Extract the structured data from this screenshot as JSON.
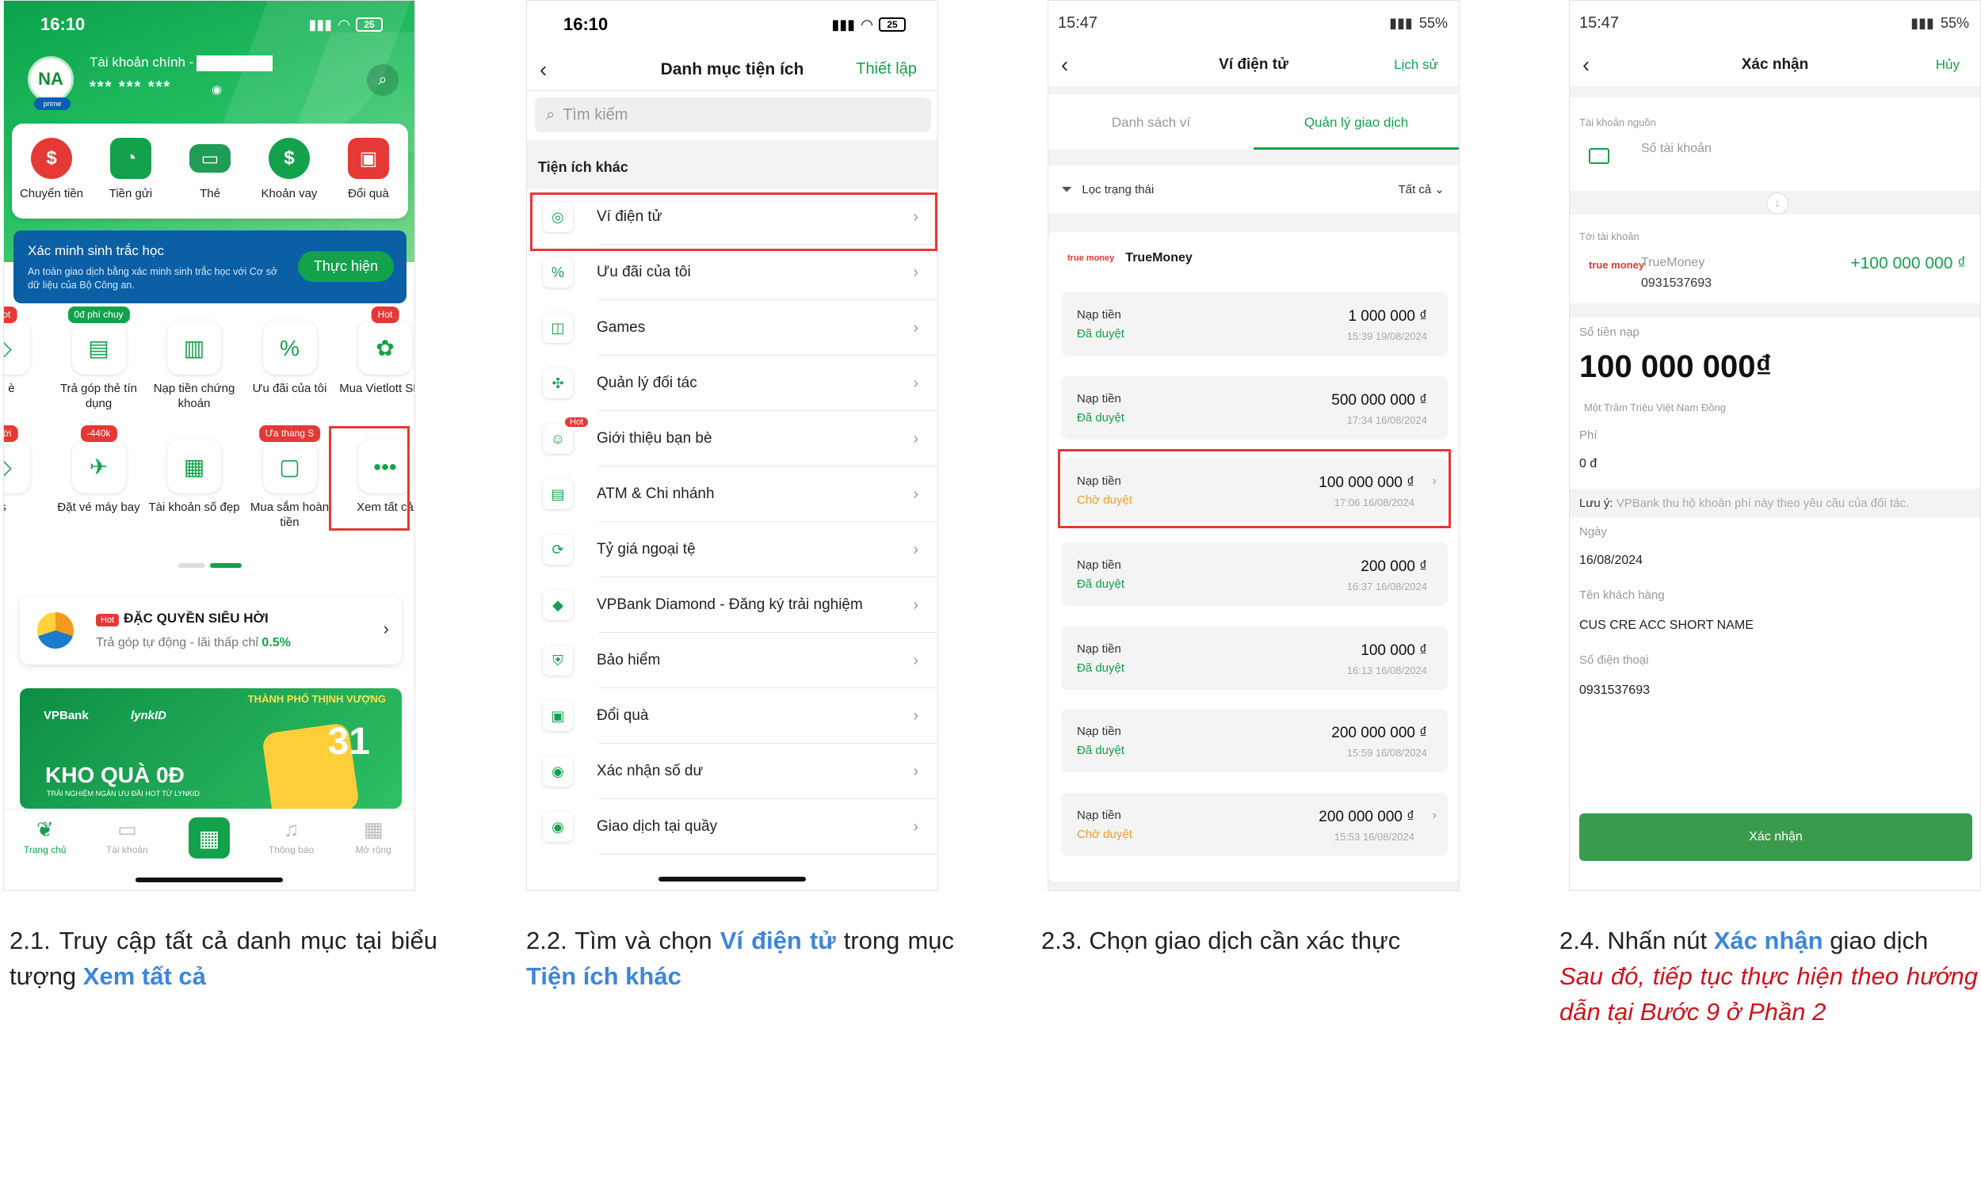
{
  "colors": {
    "brand_green": "#12a24b",
    "link_blue": "#3d86dc",
    "highlight_red": "#e53935",
    "pending_orange": "#f0a024"
  },
  "step1": {
    "status_time": "16:10",
    "battery": "25",
    "avatar_initials": "NA",
    "account_label": "Tài khoản chính -",
    "balance_masked": "*** *** ***",
    "quick_actions": [
      "Chuyển tiền",
      "Tiền gửi",
      "Thẻ",
      "Khoản vay",
      "Đổi quà"
    ],
    "bio_title": "Xác minh sinh trắc học",
    "bio_desc": "An toàn giao dịch bằng xác minh sinh trắc học với Cơ sở dữ liệu của Bộ Công an.",
    "bio_button": "Thực hiện",
    "grid_row1": [
      {
        "label": "ệu è",
        "tag": "Hot"
      },
      {
        "label": "Trả góp thẻ tín dụng",
        "tag": "0đ phí chuy"
      },
      {
        "label": "Nạp tiền chứng khoán",
        "tag": ""
      },
      {
        "label": "Ưu đãi của tôi",
        "tag": ""
      },
      {
        "label": "Mua Vietlott SMS",
        "tag": "Hot"
      }
    ],
    "grid_row2": [
      {
        "label": "s",
        "tag": "Mới"
      },
      {
        "label": "Đặt vé máy bay",
        "tag": "-440k"
      },
      {
        "label": "Tài khoản số đẹp",
        "tag": ""
      },
      {
        "label": "Mua sắm hoàn tiền",
        "tag": "Ưa thang S"
      },
      {
        "label": "Xem tất cả",
        "tag": ""
      }
    ],
    "promo_hot": "Hot",
    "promo_title": "ĐẶC QUYỀN SIÊU HỜI",
    "promo_sub": "Trả góp tự động - lãi thấp chỉ",
    "promo_rate": "0.5%",
    "banner_brand": "VPBank",
    "banner_partner": "lynkID",
    "banner_big": "KHO QUÀ 0Đ",
    "banner_small": "TRẢI NGHIỆM NGÀN ƯU ĐÃI HOT TỪ LYNKID",
    "banner_city": "THÀNH PHỐ THỊNH VƯỢNG",
    "banner_num": "31",
    "nav": [
      "Trang chủ",
      "Tài khoản",
      "",
      "Thông báo",
      "Mở rộng"
    ]
  },
  "step2": {
    "status_time": "16:10",
    "battery": "25",
    "title": "Danh mục tiện ích",
    "right_action": "Thiết lập",
    "search_placeholder": "Tìm kiếm",
    "section": "Tiện ích khác",
    "items": [
      {
        "label": "Ví điện tử",
        "icon": "wallet-icon",
        "hot": ""
      },
      {
        "label": "Ưu đãi của tôi",
        "icon": "voucher-icon",
        "hot": ""
      },
      {
        "label": "Games",
        "icon": "gamepad-icon",
        "hot": ""
      },
      {
        "label": "Quản lý đối tác",
        "icon": "partner-icon",
        "hot": ""
      },
      {
        "label": "Giới thiệu bạn bè",
        "icon": "friends-icon",
        "hot": "Hot"
      },
      {
        "label": "ATM & Chi nhánh",
        "icon": "atm-icon",
        "hot": ""
      },
      {
        "label": "Tỷ giá ngoại tệ",
        "icon": "exchange-icon",
        "hot": ""
      },
      {
        "label": "VPBank Diamond - Đăng ký trải nghiệm",
        "icon": "diamond-icon",
        "hot": ""
      },
      {
        "label": "Bảo hiểm",
        "icon": "shield-icon",
        "hot": ""
      },
      {
        "label": "Đổi quà",
        "icon": "gift-icon",
        "hot": ""
      },
      {
        "label": "Xác nhận số dư",
        "icon": "balance-icon",
        "hot": ""
      },
      {
        "label": "Giao dịch tại quầy",
        "icon": "counter-icon",
        "hot": ""
      }
    ]
  },
  "step3": {
    "status_time": "15:47",
    "battery": "55%",
    "title": "Ví điện tử",
    "right_action": "Lịch sử",
    "tabs": [
      "Danh sách ví",
      "Quản lý giao dịch"
    ],
    "filter_label": "Lọc trạng thái",
    "filter_value": "Tất cả",
    "provider": "TrueMoney",
    "provider_logo": "true money",
    "transactions": [
      {
        "kind": "Nạp tiền",
        "status": "Đã duyệt",
        "amount": "1 000 000 ₫",
        "datetime": "15:39 19/08/2024",
        "pending": false
      },
      {
        "kind": "Nạp tiền",
        "status": "Đã duyệt",
        "amount": "500 000 000 ₫",
        "datetime": "17:34 16/08/2024",
        "pending": false
      },
      {
        "kind": "Nạp tiền",
        "status": "Chờ duyệt",
        "amount": "100 000 000 ₫",
        "datetime": "17:06 16/08/2024",
        "pending": true
      },
      {
        "kind": "Nạp tiền",
        "status": "Đã duyệt",
        "amount": "200 000 ₫",
        "datetime": "16:37 16/08/2024",
        "pending": false
      },
      {
        "kind": "Nạp tiền",
        "status": "Đã duyệt",
        "amount": "100 000 ₫",
        "datetime": "16:13 16/08/2024",
        "pending": false
      },
      {
        "kind": "Nạp tiền",
        "status": "Đã duyệt",
        "amount": "200 000 000 ₫",
        "datetime": "15:59 16/08/2024",
        "pending": false
      },
      {
        "kind": "Nạp tiền",
        "status": "Chờ duyệt",
        "amount": "200 000 000 ₫",
        "datetime": "15:53 16/08/2024",
        "pending": true
      }
    ]
  },
  "step4": {
    "status_time": "15:47",
    "battery": "55%",
    "title": "Xác nhận",
    "right_action": "Hủy",
    "source_label": "Tài khoản nguồn",
    "source_value": "Số tài khoản",
    "dest_label": "Tới tài khoản",
    "dest_logo": "true money",
    "dest_name": "TrueMoney",
    "dest_phone": "0931537693",
    "dest_amount": "+100 000 000 ₫",
    "amount_label": "Số tiền nạp",
    "amount": "100 000 000₫",
    "amount_words": "Một Trăm Triệu  Việt Nam Đồng",
    "fee_label": "Phí",
    "fee_value": "0 đ",
    "note_prefix": "Lưu ý:",
    "note_text": "VPBank thu hộ khoản phí này theo yêu cầu của đối tác.",
    "date_label": "Ngày",
    "date_value": "16/08/2024",
    "customer_label": "Tên khách hàng",
    "customer_value": "CUS CRE ACC SHORT NAME",
    "phone_label": "Số điện thoại",
    "phone_value": "0931537693",
    "confirm_button": "Xác nhận"
  },
  "captions": {
    "c1_pre": "2.1. Truy cập tất cả danh mục tại biểu tượng ",
    "c1_hl": "Xem tất cả",
    "c2_pre": "2.2. Tìm và chọn ",
    "c2_hl1": "Ví điện tử",
    "c2_mid": " trong mục ",
    "c2_hl2": "Tiện ích khác",
    "c3": "2.3. Chọn giao dịch cần xác thực",
    "c4_pre": "2.4. Nhấn nút ",
    "c4_hl": "Xác nhận",
    "c4_post": " giao dịch",
    "c4_note": "Sau đó, tiếp tục thực hiện theo hướng dẫn tại Bước 9 ở Phần 2"
  }
}
